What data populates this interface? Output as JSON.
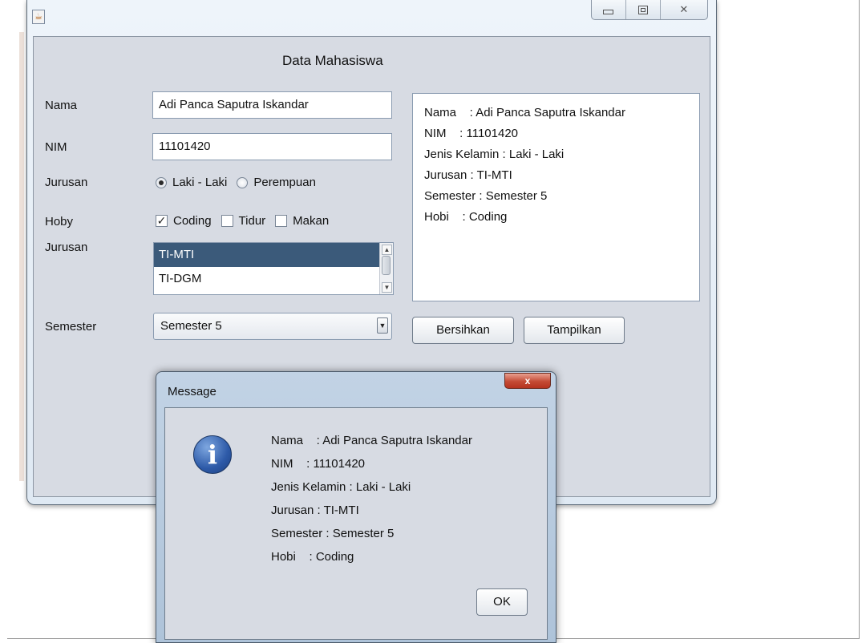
{
  "form": {
    "title": "Data Mahasiswa",
    "labels": {
      "nama": "Nama",
      "nim": "NIM",
      "jurusan_gender": "Jurusan",
      "hoby": "Hoby",
      "jurusan": "Jurusan",
      "semester": "Semester"
    },
    "nama_value": "Adi Panca Saputra Iskandar",
    "nim_value": "11101420",
    "gender_options": [
      {
        "label": "Laki - Laki",
        "selected": true
      },
      {
        "label": "Perempuan",
        "selected": false
      }
    ],
    "hobby_options": [
      {
        "label": "Coding",
        "checked": true
      },
      {
        "label": "Tidur",
        "checked": false
      },
      {
        "label": "Makan",
        "checked": false
      }
    ],
    "jurusan_list": [
      "TI-MTI",
      "TI-DGM"
    ],
    "jurusan_selected": "TI-MTI",
    "semester_value": "Semester 5",
    "output_text": "Nama    : Adi Panca Saputra Iskandar\nNIM    : 11101420\nJenis Kelamin : Laki - Laki\nJurusan : TI-MTI\nSemester : Semester 5\nHobi    : Coding",
    "buttons": {
      "clear": "Bersihkan",
      "show": "Tampilkan"
    }
  },
  "dialog": {
    "title": "Message",
    "close_label": "x",
    "icon": "info-icon",
    "icon_glyph": "i",
    "message": "Nama    : Adi Panca Saputra Iskandar\nNIM    : 11101420\nJenis Kelamin : Laki - Laki\nJurusan : TI-MTI\nSemester : Semester 5\nHobi    : Coding",
    "ok_label": "OK"
  },
  "colors": {
    "selection": "#3b5a7a",
    "dialog_close": "#c44a34",
    "info_icon": "#2d5aa8"
  }
}
